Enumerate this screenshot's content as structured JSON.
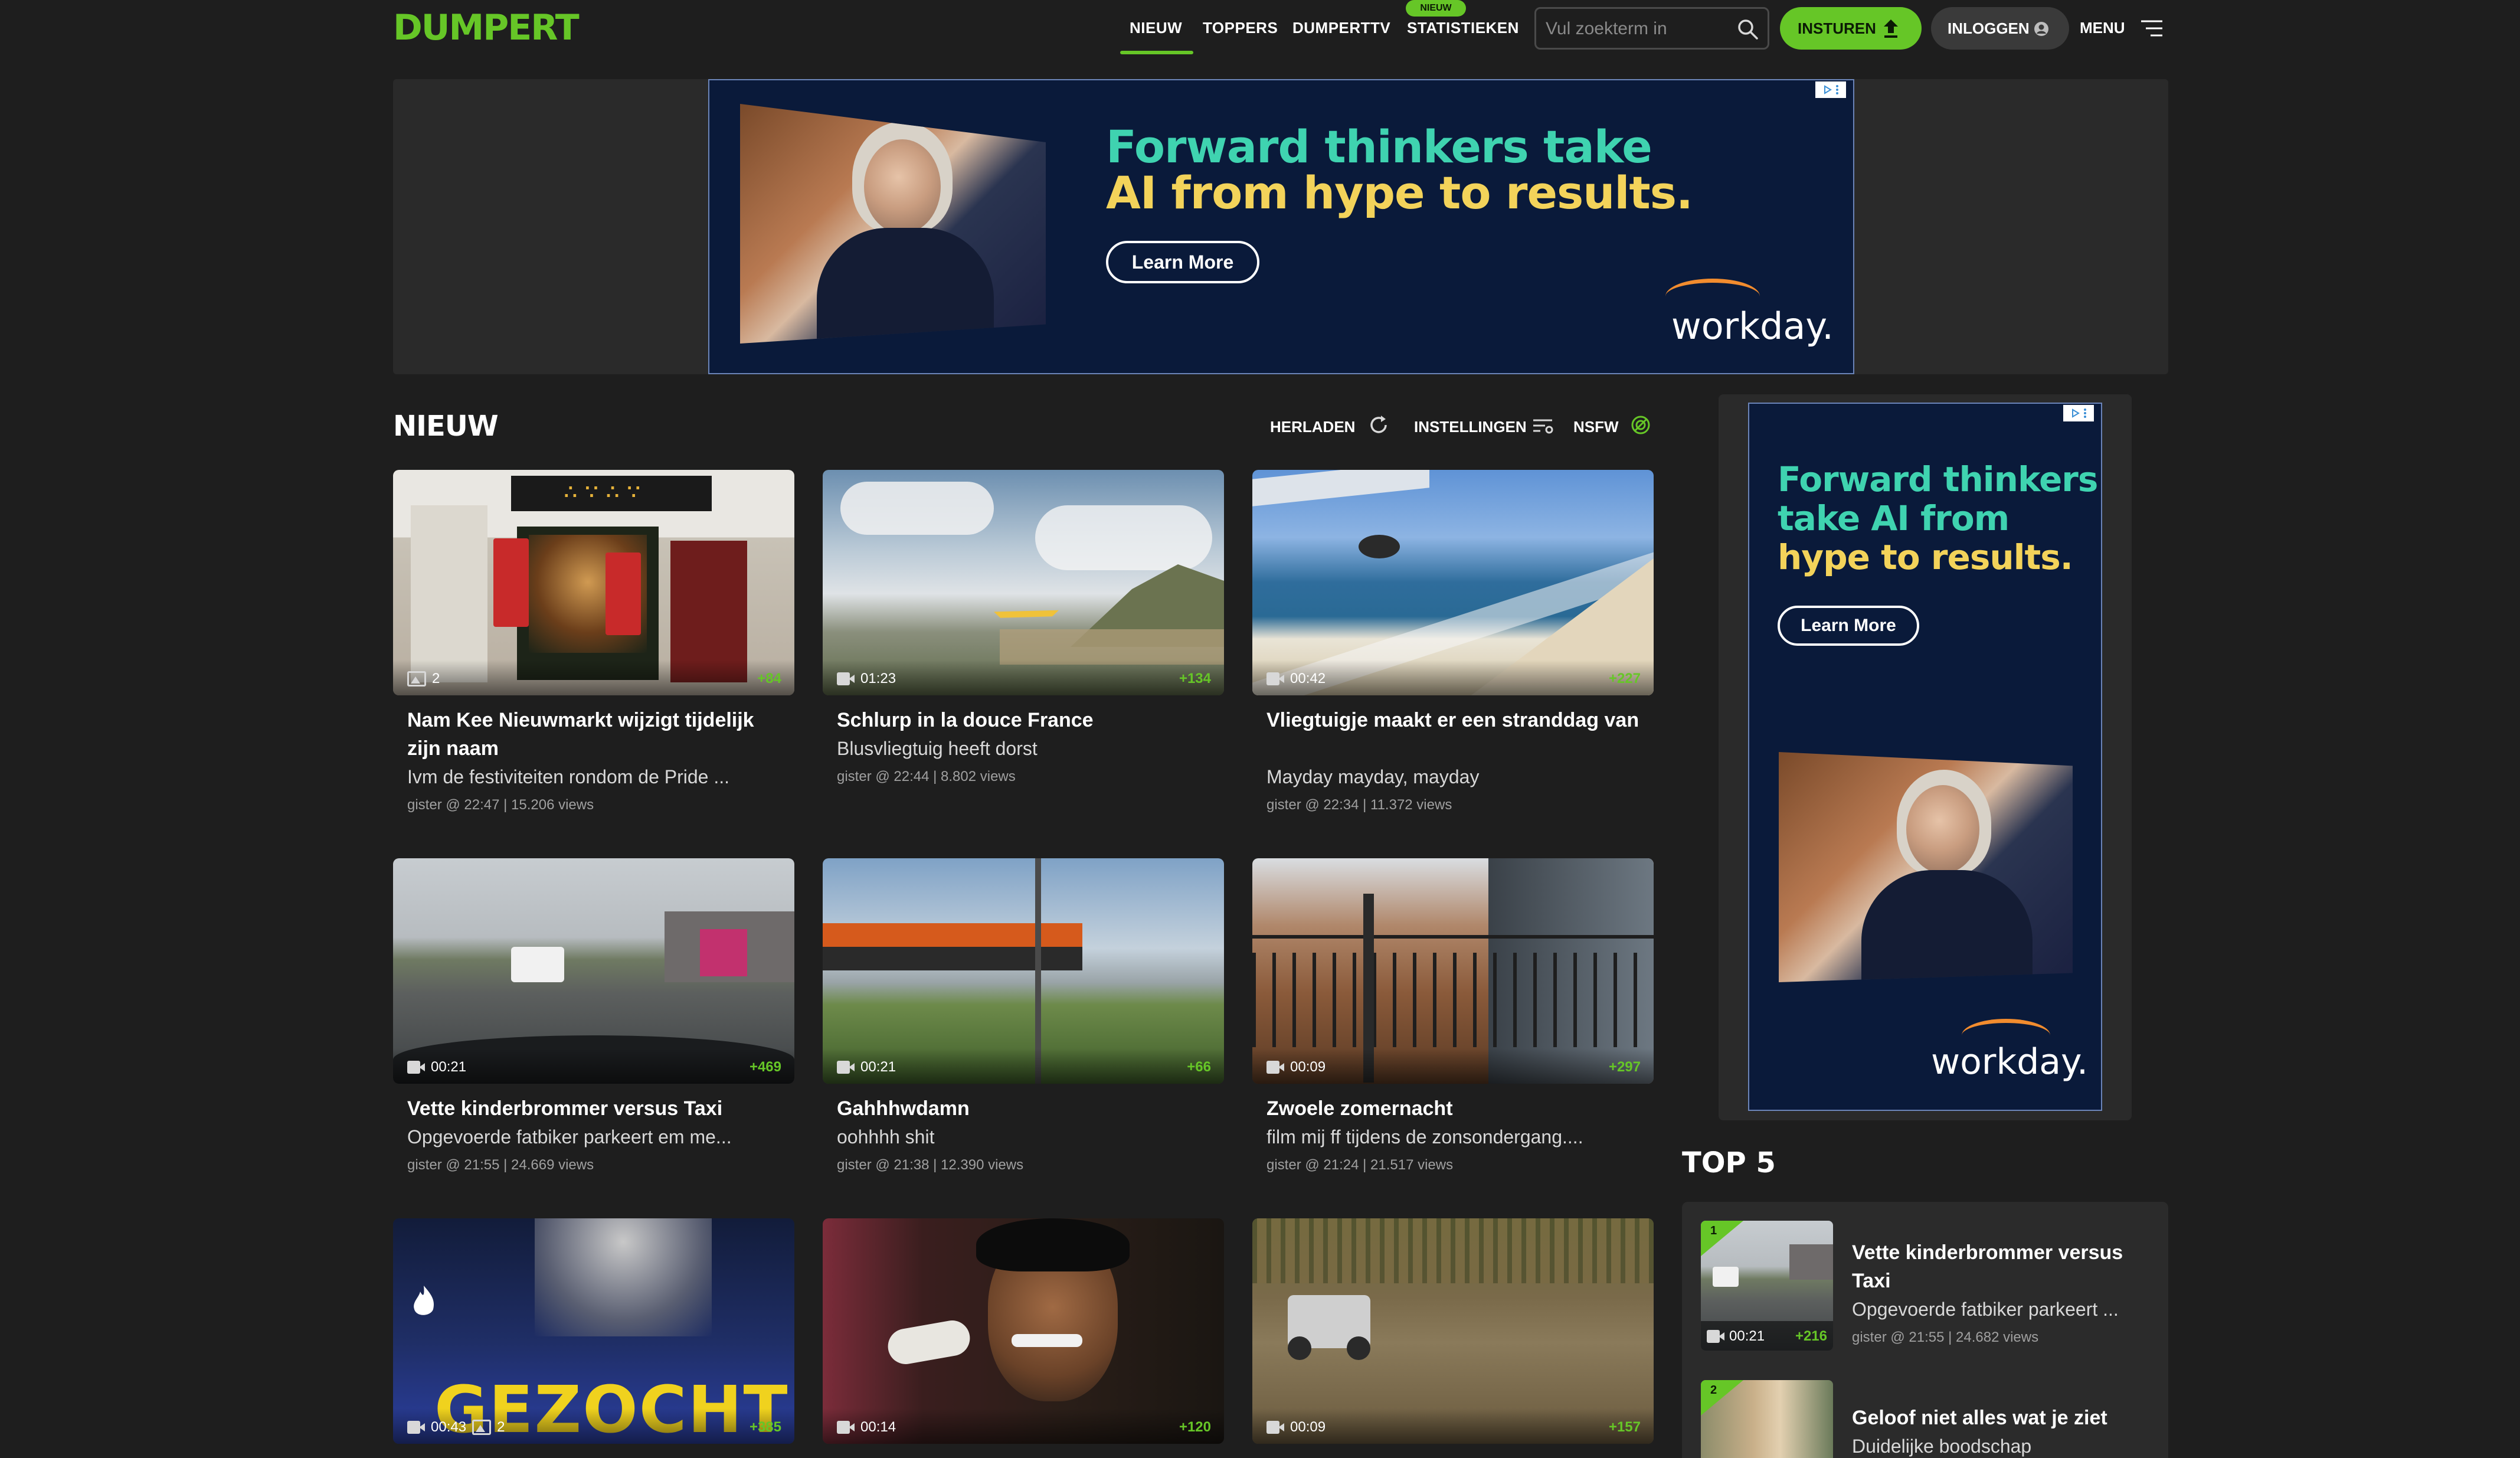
{
  "brand": {
    "logo": "DUMPERT",
    "accent": "#66c627"
  },
  "nav": {
    "items": [
      {
        "label": "NIEUW"
      },
      {
        "label": "TOPPERS"
      },
      {
        "label": "DUMPERTTV"
      },
      {
        "label": "STATISTIEKEN"
      }
    ],
    "active": "NIEUW",
    "new_badge": "NIEUW"
  },
  "search": {
    "placeholder": "Vul zoekterm in",
    "value": ""
  },
  "actions": {
    "submit": "INSTUREN",
    "login": "INLOGGEN",
    "menu": "MENU"
  },
  "ads": {
    "top": {
      "line1": "Forward thinkers take",
      "line2": "AI from hype to results.",
      "cta": "Learn More",
      "brand": "workday."
    },
    "side": {
      "line1": "Forward thinkers",
      "line2": "take AI from",
      "line3": "hype to results.",
      "cta": "Learn More",
      "brand": "workday."
    }
  },
  "section": {
    "title": "NIEUW",
    "tools": {
      "reload": "HERLADEN",
      "settings": "INSTELLINGEN",
      "nsfw": "NSFW"
    }
  },
  "items": [
    {
      "title": "Nam Kee Nieuwmarkt wijzigt tijdelijk zijn naam",
      "subtitle": "Ivm de festiviteiten rondom de Pride ...",
      "info": "gister @ 22:47 | 15.206 views",
      "media": "photo",
      "count": "2",
      "kudos": "+84"
    },
    {
      "title": "Schlurp in la douce France",
      "subtitle": "Blusvliegtuig heeft dorst",
      "info": "gister @ 22:44 | 8.802 views",
      "media": "video",
      "duration": "01:23",
      "kudos": "+134"
    },
    {
      "title": "Vliegtuigje maakt er een stranddag van",
      "subtitle": "Mayday mayday, mayday",
      "info": "gister @ 22:34 | 11.372 views",
      "media": "video",
      "duration": "00:42",
      "kudos": "+227"
    },
    {
      "title": "Vette kinderbrommer versus Taxi",
      "subtitle": "Opgevoerde fatbiker parkeert em me...",
      "info": "gister @ 21:55 | 24.669 views",
      "media": "video",
      "duration": "00:21",
      "kudos": "+469"
    },
    {
      "title": "Gahhhwdamn",
      "subtitle": "oohhhh shit",
      "info": "gister @ 21:38 | 12.390 views",
      "media": "video",
      "duration": "00:21",
      "kudos": "+66"
    },
    {
      "title": "Zwoele zomernacht",
      "subtitle": "film mij ff tijdens de zonsondergang....",
      "info": "gister @ 21:24 | 21.517 views",
      "media": "video",
      "duration": "00:09",
      "kudos": "+297"
    },
    {
      "overlay_text": "GEZOCHT",
      "media": "video",
      "duration": "00:43",
      "count": "2",
      "kudos": "+385"
    },
    {
      "media": "video",
      "duration": "00:14",
      "kudos": "+120"
    },
    {
      "media": "video",
      "duration": "00:09",
      "kudos": "+157"
    }
  ],
  "top5": {
    "title": "TOP 5",
    "items": [
      {
        "rank": "1",
        "title": "Vette kinderbrommer versus Taxi",
        "subtitle": "Opgevoerde fatbiker parkeert ...",
        "info": "gister @ 21:55 | 24.682 views",
        "duration": "00:21",
        "kudos": "+216"
      },
      {
        "rank": "2",
        "title": "Geloof niet alles wat je ziet",
        "subtitle": "Duidelijke boodschap"
      }
    ]
  }
}
